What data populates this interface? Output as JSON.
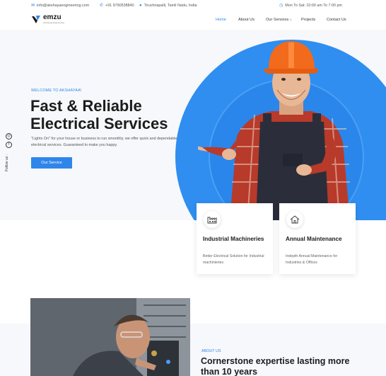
{
  "topbar": {
    "email": "info@akshayaengineering.com",
    "phone": "+91 9790538840",
    "location": "Tiruchirapalli, Tamil Nadu, India",
    "hours": "Mon To Sat: 10:00 am To 7:00 pm"
  },
  "brand": {
    "name": "emzu",
    "tagline": "Akshayaa Engineering"
  },
  "nav": {
    "items": [
      "Home",
      "About Us",
      "Our Services ↓",
      "Projects",
      "Contact Us"
    ],
    "active": "Home"
  },
  "social": {
    "follow_label": "Follow us :",
    "icons": [
      "instagram-icon",
      "facebook-icon"
    ]
  },
  "hero": {
    "kicker": "WELCOME TO AKSHAYAA!",
    "headline_line1": "Fast & Reliable",
    "headline_line2": "Electrical Services",
    "description": "\"Lights On\" for your house or business to run smoothly, we offer quick and dependable electrical services. Guaranteed to make you happy.",
    "button": "Our Service"
  },
  "cards": [
    {
      "icon": "factory-icon",
      "title": "Industrial Machineries",
      "text": "Better Electrical Solution for Industrial machinieries"
    },
    {
      "icon": "house-icon",
      "title": "Annual Maintenance",
      "text": "Indepth Annual Maintenance for Industries & Offices"
    }
  ],
  "about": {
    "kicker": "ABOUT US",
    "title": "Cornerstone expertise lasting more than 10 years"
  },
  "colors": {
    "accent": "#2f86ea",
    "hero_bg": "#f6f8fb",
    "disc": "#2f8ef0"
  }
}
